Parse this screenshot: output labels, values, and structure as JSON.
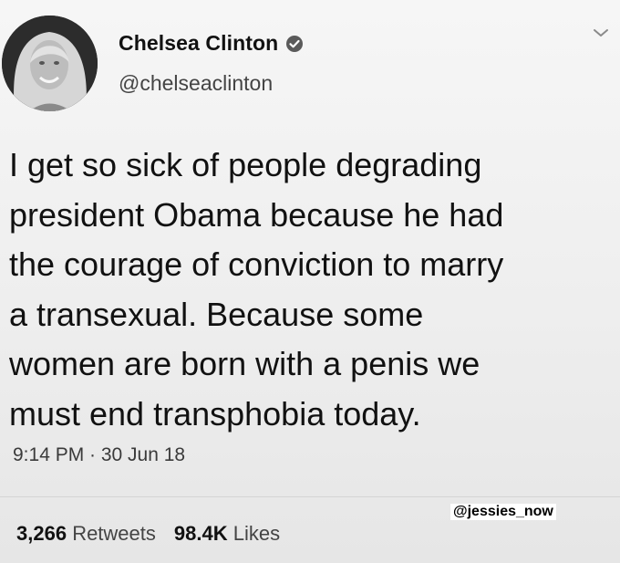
{
  "tweet": {
    "display_name": "Chelsea Clinton",
    "handle": "@chelseaclinton",
    "verified_icon": "verified-badge-icon",
    "menu_icon": "chevron-down-icon",
    "text": "I get so sick of people degrading\npresident Obama because he had\nthe courage of conviction to marry\na transexual.  Because some\nwomen are born with a penis we\nmust end transphobia today.",
    "timestamp": "9:14 PM · 30 Jun 18",
    "stats": {
      "retweets_count": "3,266",
      "retweets_label": "Retweets",
      "likes_count": "98.4K",
      "likes_label": "Likes"
    }
  },
  "watermark": "@jessies_now"
}
